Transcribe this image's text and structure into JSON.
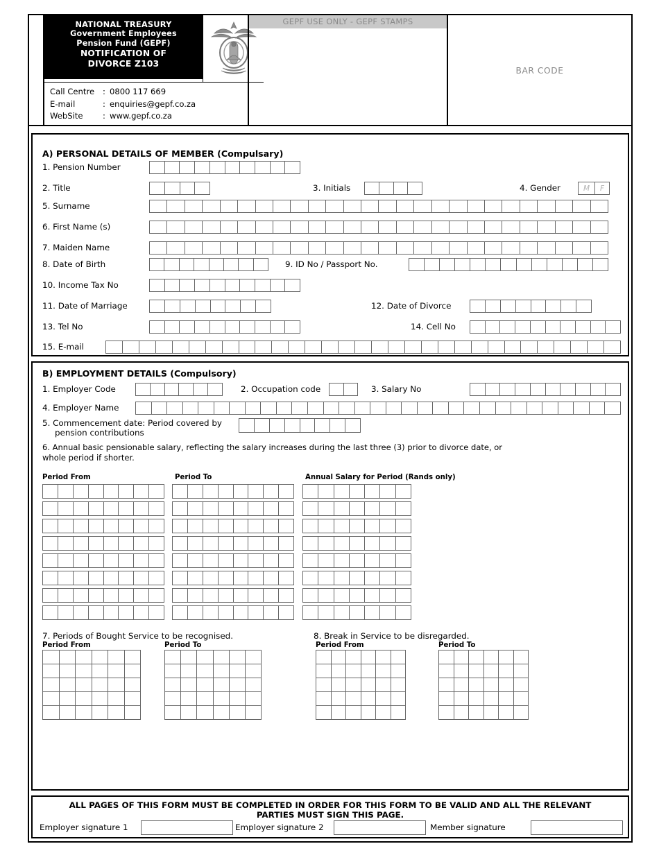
{
  "document": {
    "form_code": "Z103",
    "header": {
      "title_lines": [
        "NATIONAL TREASURY",
        "Government Employees",
        "Pension Fund (GEPF)",
        "NOTIFICATION OF",
        "DIVORCE  Z103"
      ],
      "crest_icon": "south-african-coat-of-arms-icon",
      "contact": [
        {
          "label": "Call Centre",
          "sep": ":",
          "value": "0800 117 669"
        },
        {
          "label": "E-mail",
          "sep": ":",
          "value": "enquiries@gepf.co.za"
        },
        {
          "label": "WebSite",
          "sep": ":",
          "value": "www.gepf.co.za"
        }
      ],
      "stamp_box_title": "GEPF USE ONLY - GEPF STAMPS",
      "barcode_label": "BAR CODE"
    },
    "section_a": {
      "title": "A) PERSONAL DETAILS OF MEMBER (Compulsary)",
      "fields": [
        {
          "no": "1.",
          "label": "1. Pension Number",
          "cells": 10
        },
        {
          "no": "2.",
          "label": "2. Title",
          "cells": 4
        },
        {
          "no": "3.",
          "label": "3. Initials",
          "cells": 4
        },
        {
          "no": "4.",
          "label": "4. Gender",
          "cells": 2,
          "cell_text": [
            "M",
            "F"
          ]
        },
        {
          "no": "5.",
          "label": "5. Surname",
          "cells": 26
        },
        {
          "no": "6.",
          "label": "6. First Name (s)",
          "cells": 26
        },
        {
          "no": "7.",
          "label": "7. Maiden Name",
          "cells": 26
        },
        {
          "no": "8.",
          "label": "8. Date of Birth",
          "cells": 8
        },
        {
          "no": "9.",
          "label": "9. ID No / Passport No.",
          "cells": 13
        },
        {
          "no": "10.",
          "label": "10. Income Tax No",
          "cells": 10
        },
        {
          "no": "11.",
          "label": "11. Date of Marriage",
          "cells": 8
        },
        {
          "no": "12.",
          "label": "12. Date of Divorce",
          "cells": 8
        },
        {
          "no": "13.",
          "label": "13. Tel No",
          "cells": 10
        },
        {
          "no": "14.",
          "label": "14. Cell No",
          "cells": 10
        },
        {
          "no": "15.",
          "label": "15. E-mail",
          "cells": 31
        }
      ]
    },
    "section_b": {
      "title": "B) EMPLOYMENT DETAILS (Compulsory)",
      "fields": [
        {
          "label": "1. Employer Code",
          "cells": 6
        },
        {
          "label": "2. Occupation code",
          "cells": 2
        },
        {
          "label": "3. Salary No",
          "cells": 10
        },
        {
          "label": "4. Employer Name",
          "cells": 31
        },
        {
          "label_line1": "5. Commencement date: Period covered by",
          "label_line2": "pension  contributions",
          "cells": 8
        }
      ],
      "item6": {
        "text_line1": "6. Annual basic pensionable salary, reflecting the salary increases during the last three (3) prior to divorce date, or",
        "text_line2": "whole period if shorter.",
        "columns": [
          {
            "header": "Period From",
            "cells": 8
          },
          {
            "header": "Period To",
            "cells": 8
          },
          {
            "header": "Annual Salary for  Period (Rands only)",
            "cells": 7
          }
        ],
        "rows": 8
      },
      "item7": {
        "text": "7. Periods of Bought  Service to be recognised.",
        "columns": [
          {
            "header": "Period From",
            "cols": 6,
            "rows": 5
          },
          {
            "header": "Period To",
            "cols": 6,
            "rows": 5
          }
        ]
      },
      "item8": {
        "text": "8. Break in Service to be disregarded.",
        "columns": [
          {
            "header": "Period From",
            "cols": 6,
            "rows": 5
          },
          {
            "header": "Period To",
            "cols": 6,
            "rows": 5
          }
        ]
      }
    },
    "footer": {
      "notice_line1": "ALL PAGES OF THIS FORM MUST BE COMPLETED IN ORDER FOR THIS FORM TO BE VALID AND ALL THE RELEVANT",
      "notice_line2": "PARTIES MUST SIGN THIS PAGE.",
      "signatures": [
        {
          "label": "Employer signature 1"
        },
        {
          "label": "Employer signature 2"
        },
        {
          "label": "Member signature"
        }
      ]
    },
    "colors": {
      "header_black": "#000000",
      "stamp_band_grey": "#c8c8c8",
      "placeholder_grey": "#b4b4b4",
      "cell_border": "#666666"
    }
  }
}
